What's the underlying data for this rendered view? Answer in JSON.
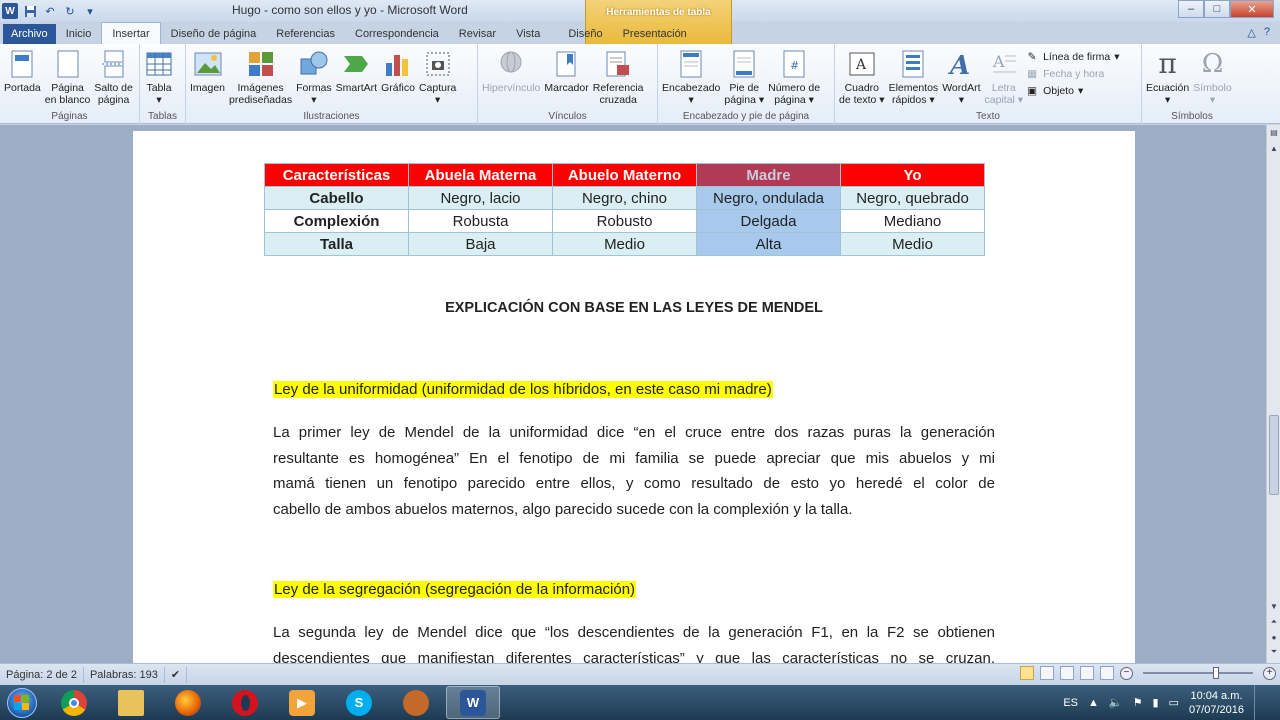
{
  "window": {
    "title": "Hugo - como son ellos y yo  -  Microsoft Word",
    "context_tab_header": "Herramientas de tabla"
  },
  "tabs": [
    "Archivo",
    "Inicio",
    "Insertar",
    "Diseño de página",
    "Referencias",
    "Correspondencia",
    "Revisar",
    "Vista",
    "Diseño",
    "Presentación"
  ],
  "active_tab": "Insertar",
  "ribbon": {
    "paginas": {
      "label": "Páginas",
      "portada": "Portada",
      "pagina_blanco_1": "Página",
      "pagina_blanco_2": "en blanco",
      "salto_1": "Salto de",
      "salto_2": "página"
    },
    "tablas": {
      "label": "Tablas",
      "tabla": "Tabla"
    },
    "ilustraciones": {
      "label": "Ilustraciones",
      "imagen": "Imagen",
      "imagenes_1": "Imágenes",
      "imagenes_2": "prediseñadas",
      "formas": "Formas",
      "smartart": "SmartArt",
      "grafico": "Gráfico",
      "captura": "Captura"
    },
    "vinculos": {
      "label": "Vínculos",
      "hipervinculo": "Hipervínculo",
      "marcador": "Marcador",
      "referencia_1": "Referencia",
      "referencia_2": "cruzada"
    },
    "encabezado": {
      "label": "Encabezado y pie de página",
      "encabezado": "Encabezado",
      "pie_1": "Pie de",
      "pie_2": "página",
      "numero_1": "Número de",
      "numero_2": "página"
    },
    "texto": {
      "label": "Texto",
      "cuadro_1": "Cuadro",
      "cuadro_2": "de texto",
      "elementos_1": "Elementos",
      "elementos_2": "rápidos",
      "wordart": "WordArt",
      "letra_1": "Letra",
      "letra_2": "capital",
      "linea_firma": "Línea de firma",
      "fecha_hora": "Fecha y hora",
      "objeto": "Objeto"
    },
    "simbolos": {
      "label": "Símbolos",
      "ecuacion": "Ecuación",
      "simbolo": "Símbolo"
    }
  },
  "table": {
    "headers": [
      "Características",
      "Abuela Materna",
      "Abuelo Materno",
      "Madre",
      "Yo"
    ],
    "rows": [
      [
        "Cabello",
        "Negro, lacio",
        "Negro, chino",
        "Negro, ondulada",
        "Negro, quebrado"
      ],
      [
        "Complexión",
        "Robusta",
        "Robusto",
        "Delgada",
        "Mediano"
      ],
      [
        "Talla",
        "Baja",
        "Medio",
        "Alta",
        "Medio"
      ]
    ]
  },
  "document": {
    "heading": "EXPLICACIÓN CON BASE EN LAS LEYES DE MENDEL",
    "law1": "Ley de la uniformidad   (uniformidad de los híbridos, en este caso mi madre)",
    "para1": [
      "La primer ley de Mendel de la uniformidad dice “en el cruce entre dos razas puras la generación",
      "resultante es homogénea” En el fenotipo de mi familia se puede apreciar que mis abuelos y mi",
      "mamá tienen un fenotipo parecido entre ellos, y como resultado de esto yo heredé el color de",
      "cabello de ambos abuelos maternos,  algo parecido sucede con  la complexión y la talla."
    ],
    "law2": "Ley de la segregación  (segregación de la información)",
    "para2": [
      "La segunda ley de Mendel dice que “los descendientes  de la generación F1, en la F2 se obtienen",
      "descendientes  que manifiestan  diferentes  características”  y que las características  no se cruzan,"
    ]
  },
  "statusbar": {
    "page": "Página: 2 de 2",
    "words": "Palabras: 193"
  },
  "taskbar": {
    "lang": "ES",
    "time": "10:04 a.m.",
    "date": "07/07/2016"
  }
}
